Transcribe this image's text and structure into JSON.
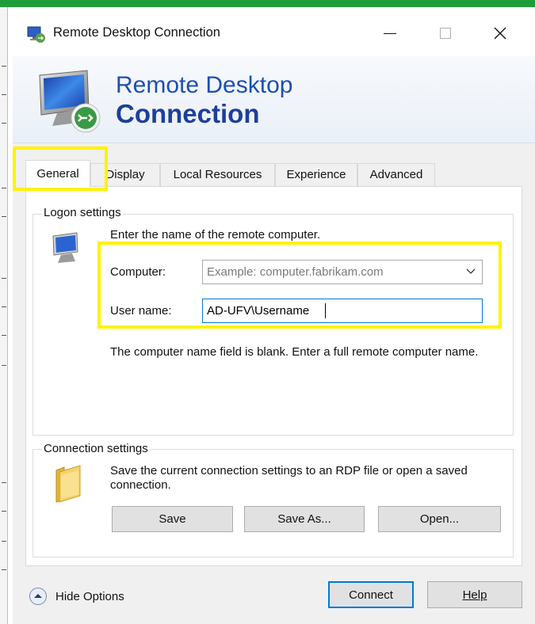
{
  "window": {
    "title": "Remote Desktop Connection",
    "controls": {
      "minimize": "—",
      "maximize": "☐",
      "close": "✕"
    }
  },
  "banner": {
    "line1": "Remote Desktop",
    "line2": "Connection"
  },
  "tabs": [
    {
      "label": "General",
      "active": true
    },
    {
      "label": "Display",
      "active": false
    },
    {
      "label": "Local Resources",
      "active": false
    },
    {
      "label": "Experience",
      "active": false
    },
    {
      "label": "Advanced",
      "active": false
    }
  ],
  "logon": {
    "group_label": "Logon settings",
    "instruction": "Enter the name of the remote computer.",
    "computer_label": "Computer:",
    "computer_placeholder": "Example: computer.fabrikam.com",
    "username_label": "User name:",
    "username_value": "AD-UFV\\Username",
    "status": "The computer name field is blank. Enter a full remote computer name."
  },
  "connection": {
    "group_label": "Connection settings",
    "description": "Save the current connection settings to an RDP file or open a saved connection.",
    "save_label": "Save",
    "save_as_label": "Save As...",
    "open_label": "Open..."
  },
  "footer": {
    "hide_options_label": "Hide Options",
    "connect_label": "Connect",
    "help_label": "Help"
  },
  "icons": {
    "app": "remote-desktop-icon",
    "banner": "remote-desktop-monitor-icon",
    "computer": "computer-monitor-icon",
    "folder": "folder-icon",
    "hide": "chevron-up-circle-icon",
    "dropdown": "chevron-down-icon"
  },
  "colors": {
    "accent": "#0078d7",
    "banner_text": "#1d4fb3",
    "highlight": "#fff200",
    "top_bar": "#1e9e3b"
  }
}
